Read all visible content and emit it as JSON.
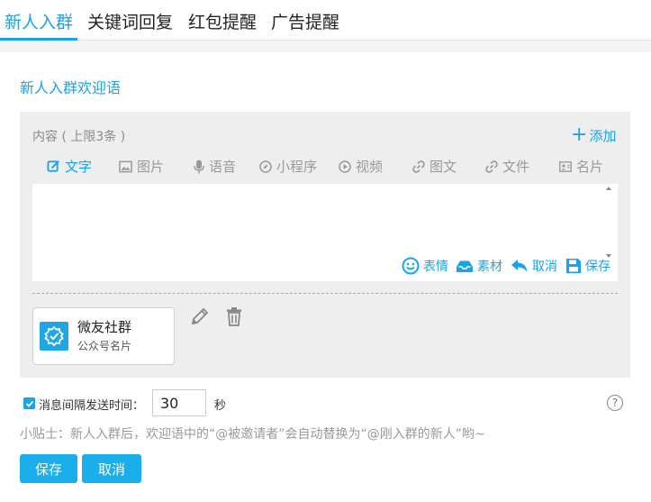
{
  "tabs": [
    {
      "label": "新人入群"
    },
    {
      "label": "关键词回复"
    },
    {
      "label": "红包提醒"
    },
    {
      "label": "广告提醒"
    }
  ],
  "section_title": "新人入群欢迎语",
  "editor": {
    "content_label": "内容 ( 上限3条 )",
    "add_label": "添加",
    "type_tabs": [
      {
        "label": "文字",
        "icon": "edit-icon"
      },
      {
        "label": "图片",
        "icon": "image-icon"
      },
      {
        "label": "语音",
        "icon": "microphone-icon"
      },
      {
        "label": "小程序",
        "icon": "compass-icon"
      },
      {
        "label": "视频",
        "icon": "play-icon"
      },
      {
        "label": "图文",
        "icon": "link-icon"
      },
      {
        "label": "文件",
        "icon": "link-icon"
      },
      {
        "label": "名片",
        "icon": "contact-card-icon"
      }
    ],
    "text_value": "",
    "tools": [
      {
        "label": "表情",
        "icon": "smiley-icon"
      },
      {
        "label": "素材",
        "icon": "inbox-icon"
      },
      {
        "label": "取消",
        "icon": "undo-icon"
      },
      {
        "label": "保存",
        "icon": "floppy-disk-icon"
      }
    ]
  },
  "card": {
    "name": "微友社群",
    "type": "公众号名片",
    "icon": "verified-badge-icon"
  },
  "interval": {
    "checked": true,
    "label": "消息间隔发送时间：",
    "value": "30",
    "unit": "秒"
  },
  "tip": "小贴士：新人入群后，欢迎语中的“@被邀请者”会自动替换为“@刚入群的新人”哟~",
  "buttons": {
    "save_label": "保存",
    "cancel_label": "取消"
  },
  "colors": {
    "accent": "#1aa3e6",
    "button": "#1aaeea"
  }
}
